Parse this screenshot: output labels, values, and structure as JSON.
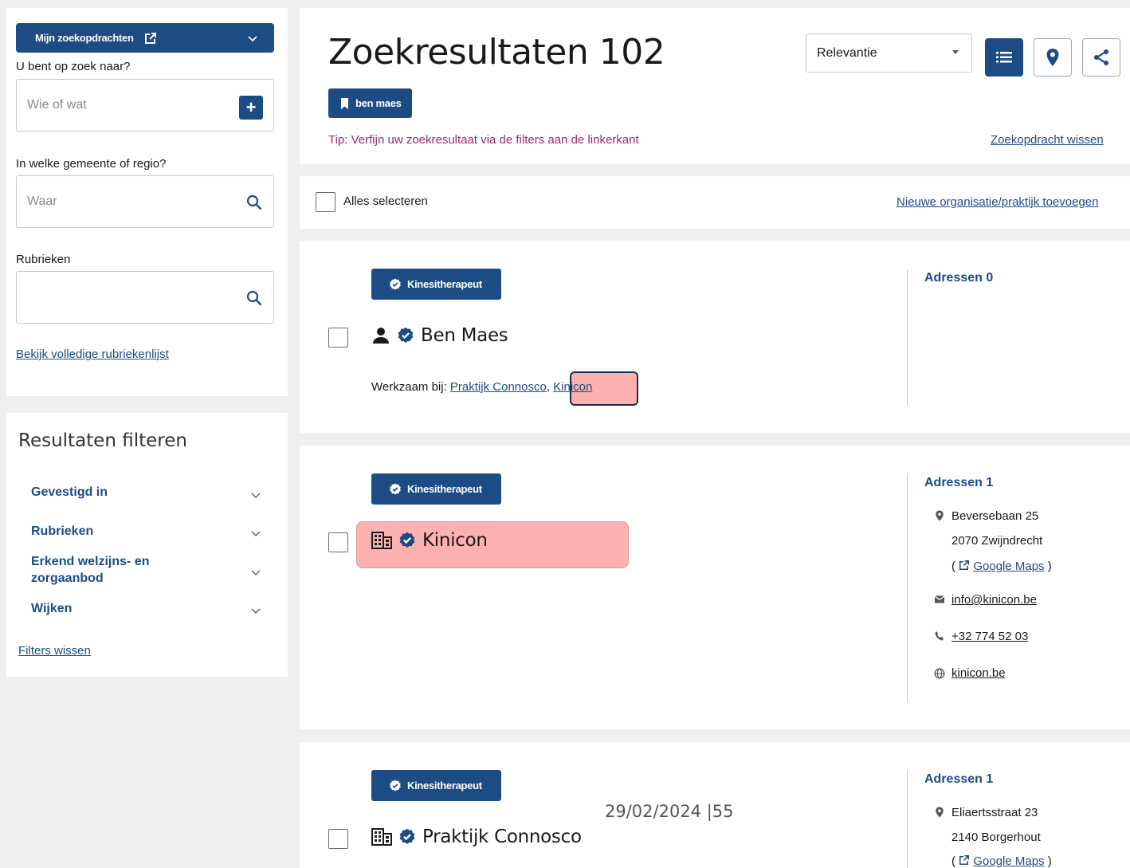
{
  "sidebar": {
    "saved_searches_label": "Mijn zoekopdrachten",
    "who_label": "U bent op zoek naar?",
    "who_placeholder": "Wie of wat",
    "where_label": "In welke gemeente of regio?",
    "where_placeholder": "Waar",
    "rubrieken_label": "Rubrieken",
    "rubrieken_value": "",
    "full_list_link": "Bekijk volledige rubriekenlijst",
    "filter_title": "Resultaten filteren",
    "facets": [
      "Gevestigd in",
      "Rubrieken",
      "Erkend welzijns- en zorgaanbod",
      "Wijken"
    ],
    "clear_filters": "Filters wissen"
  },
  "header": {
    "title": "Zoekresultaten 102",
    "sort_value": "Relevantie",
    "saved_tag": "ben maes",
    "tip": "Tip: Verfijn uw zoekresultaat via de filters aan de linkerkant",
    "clear_search": "Zoekopdracht wissen"
  },
  "toolbar": {
    "select_all": "Alles selecteren",
    "add_org": "Nieuwe organisatie/praktijk toevoegen"
  },
  "results": [
    {
      "badge": "Kinesitherapeut",
      "name": "Ben Maes",
      "work_label": "Werkzaam bij:",
      "work_link_1": "Praktijk Connosco",
      "work_sep": ",",
      "work_link_2": "Kinicon",
      "addresses_heading": "Adressen 0"
    },
    {
      "badge": "Kinesitherapeut",
      "name": "Kinicon",
      "addresses_heading": "Adressen 1",
      "street": "Beversebaan 25",
      "city": "2070 Zwijndrecht",
      "maps_open": "(",
      "maps_link": "Google Maps",
      "maps_close": ")",
      "email": "info@kinicon.be",
      "phone": "+32 774 52 03",
      "website": "kinicon.be"
    },
    {
      "badge": "Kinesitherapeut",
      "name": "Praktijk Connosco",
      "addresses_heading": "Adressen 1",
      "street": "Eliaertsstraat 23",
      "city": "2140 Borgerhout",
      "maps_open": "(",
      "maps_link": "Google Maps",
      "maps_close": ")"
    }
  ],
  "footer_stamp": "29/02/2024 |55",
  "colors": {
    "brand": "#1d4c84",
    "tip": "#9b2a6d",
    "highlight": "#fdb1b1"
  }
}
